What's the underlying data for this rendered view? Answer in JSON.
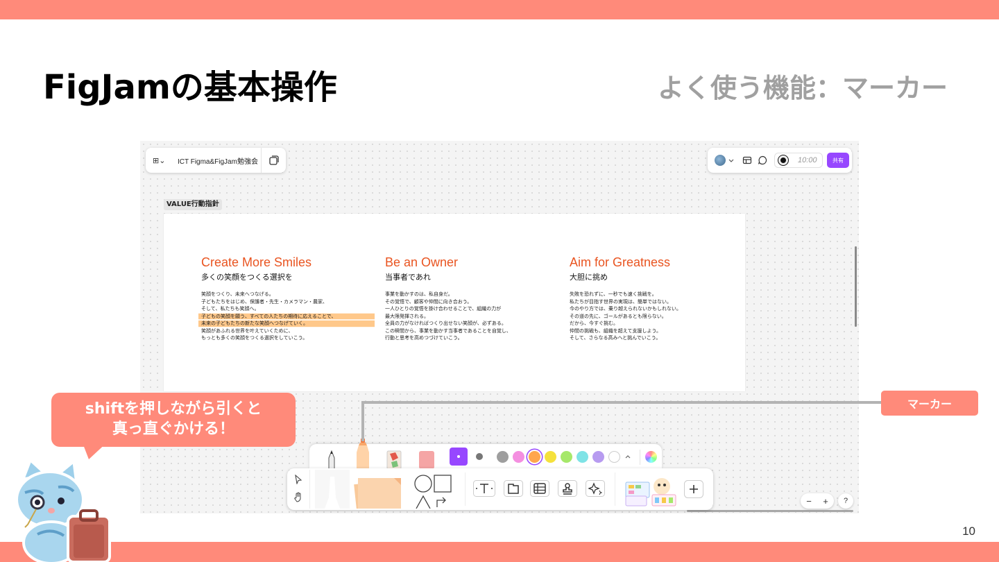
{
  "slide": {
    "title": "FigJamの基本操作",
    "subtitle": "よく使う機能：マーカー",
    "page_number": "10"
  },
  "figjam": {
    "file_name": "ICT Figma&FigJam勉強会",
    "timer": "10:00",
    "share_label": "共有",
    "frame_label": "VALUE行動指針",
    "columns": [
      {
        "heading": "Create More Smiles",
        "sub": "多くの笑顔をつくる選択を",
        "lines": [
          "笑顔をつくり、未来へつなげる。",
          "子どもたちをはじめ、保護者・先生・カメラマン・農家、",
          "そして、私たちも笑顔へ。",
          "子どもの笑顔を願う、すべての人たちの期待に応えることで、",
          "未来の子どもたちの新たな笑顔へつなげていく。",
          "笑顔があふれる世界を叶えていくために、",
          "もっとも多くの笑顔をつくる選択をしていこう。"
        ]
      },
      {
        "heading": "Be an Owner",
        "sub": "当事者であれ",
        "lines": [
          "事業を動かすのは、私自身だ。",
          "その覚悟で、顧客や仲間に向き合おう。",
          "一人ひとりの覚悟を掛け合わせることで、組織の力が",
          "最大限発揮される。",
          "全員の力がなければつくり出せない笑顔が、必ずある。",
          "この瞬間から、事業を動かす当事者であることを自覚し、",
          "行動と思考を高めつづけていこう。"
        ]
      },
      {
        "heading": "Aim for Greatness",
        "sub": "大胆に挑め",
        "lines": [
          "失敗を恐れずに、一秒でも速く挑戦を。",
          "私たちが目指す世界の実現は、簡単ではない。",
          "今のやり方では、乗り越えられないかもしれない。",
          "その道の先に、ゴールがあるとも限らない。",
          "だから、今すぐ挑む。",
          "仲間の挑戦も、組織を超えて支援しよう。",
          "そして、さらなる高みへと挑んでいこう。"
        ]
      }
    ],
    "highlighted_lines": [
      3,
      4
    ],
    "zoom": {
      "minus": "−",
      "plus": "+",
      "help": "?"
    },
    "marker_colors": [
      "#9E9E9E",
      "#F48FE0",
      "#FFA64D",
      "#F5E13C",
      "#A6E86A",
      "#7FE3E6",
      "#B79BF0",
      "#FFFFFF"
    ],
    "selected_color": "#FFA64D",
    "accent": "#9747FF"
  },
  "callout": {
    "label": "マーカー",
    "bubble_line1": "shiftを押しながら引くと",
    "bubble_line2": "真っ直ぐかける！"
  },
  "colors": {
    "brand_bar": "#FF8A7A",
    "marker_heading": "#E95420"
  }
}
